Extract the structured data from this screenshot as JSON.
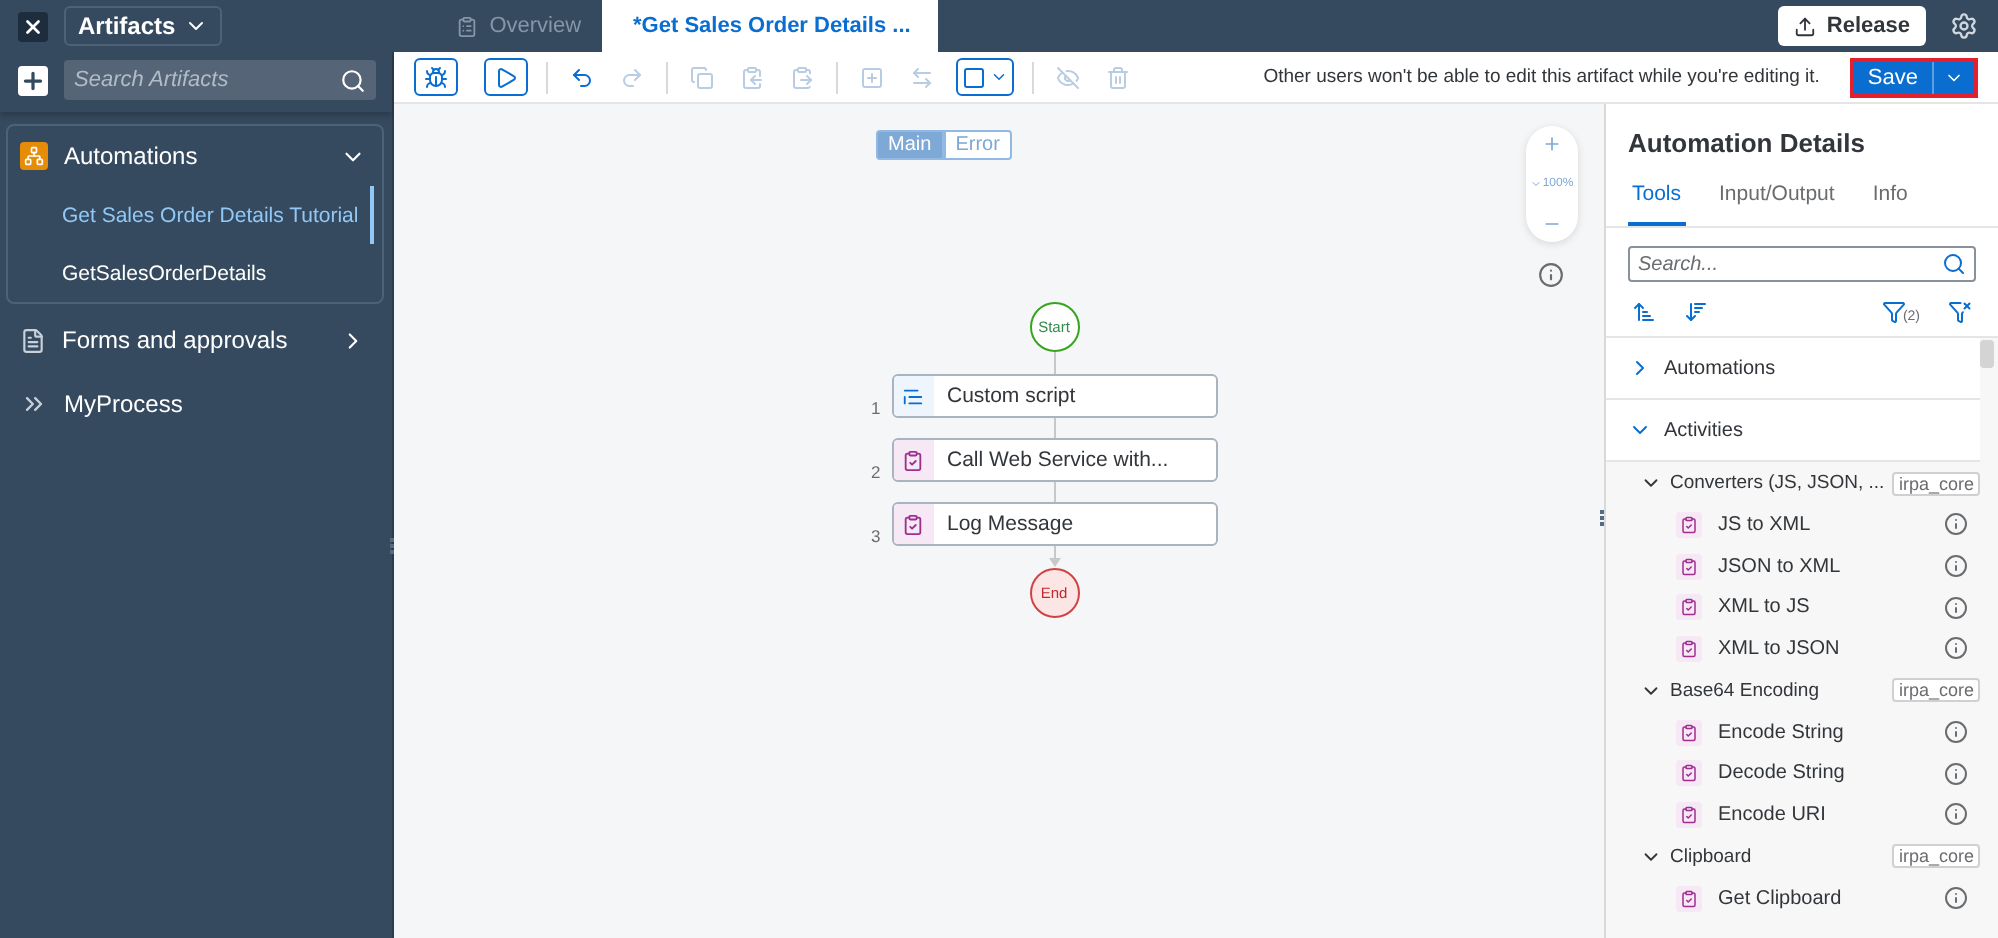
{
  "header": {
    "menu": "Artifacts",
    "tabs": [
      {
        "label": "Overview",
        "selected": false,
        "kind": "overview"
      },
      {
        "label": "*Get Sales Order Details ...",
        "selected": true,
        "kind": "automation"
      }
    ],
    "release_button": "Release"
  },
  "sidebar": {
    "search": {
      "placeholder": "Search Artifacts"
    },
    "groups": [
      {
        "label": "Automations",
        "kind": "automation",
        "expanded": true,
        "children": [
          {
            "label": "Get Sales Order Details Tutorial",
            "selected": true
          },
          {
            "label": "GetSalesOrderDetails",
            "selected": false
          }
        ]
      },
      {
        "label": "Forms and approvals",
        "kind": "form",
        "expanded": false
      },
      {
        "label": "MyProcess",
        "kind": "process"
      }
    ]
  },
  "toolbar": {
    "tools": [
      {
        "kind": "debug",
        "disabled": false
      },
      {
        "kind": "run",
        "disabled": false
      },
      {
        "kind": "undo",
        "disabled": false
      },
      {
        "kind": "redo",
        "disabled": true
      },
      {
        "kind": "copy",
        "disabled": true
      },
      {
        "kind": "cut",
        "disabled": true
      },
      {
        "kind": "paste",
        "disabled": true
      },
      {
        "kind": "group",
        "disabled": true
      },
      {
        "kind": "swap",
        "disabled": true
      },
      {
        "kind": "select",
        "disabled": false
      },
      {
        "kind": "hide",
        "disabled": true
      },
      {
        "kind": "delete",
        "disabled": true
      }
    ],
    "notice": "Other users won't be able to edit this artifact while you're editing it.",
    "save_button": "Save"
  },
  "canvas": {
    "views": [
      {
        "label": "Main",
        "selected": true
      },
      {
        "label": "Error",
        "selected": false
      }
    ],
    "zoom": "100%",
    "start": "Start",
    "steps": [
      {
        "number": "1",
        "label": "Custom script",
        "kind": "script"
      },
      {
        "number": "2",
        "label": "Call Web Service with...",
        "kind": "activity"
      },
      {
        "number": "3",
        "label": "Log Message",
        "kind": "activity"
      }
    ],
    "end": "End"
  },
  "details": {
    "title": "Automation Details",
    "tabs": [
      {
        "label": "Tools",
        "selected": true
      },
      {
        "label": "Input/Output",
        "selected": false
      },
      {
        "label": "Info",
        "selected": false
      }
    ],
    "search": {
      "placeholder": "Search..."
    },
    "filter_count": "(2)",
    "sections": [
      {
        "label": "Automations",
        "expanded": false
      },
      {
        "label": "Activities",
        "expanded": true,
        "groups": [
          {
            "label": "Converters (JS, JSON, ...",
            "tag": "irpa_core",
            "expanded": true,
            "items": [
              "JS to XML",
              "JSON to XML",
              "XML to JS",
              "XML to JSON"
            ]
          },
          {
            "label": "Base64 Encoding",
            "tag": "irpa_core",
            "expanded": true,
            "items": [
              "Encode String",
              "Decode String",
              "Encode URI"
            ]
          },
          {
            "label": "Clipboard",
            "tag": "irpa_core",
            "expanded": true,
            "items": [
              "Get Clipboard"
            ]
          }
        ]
      }
    ]
  }
}
